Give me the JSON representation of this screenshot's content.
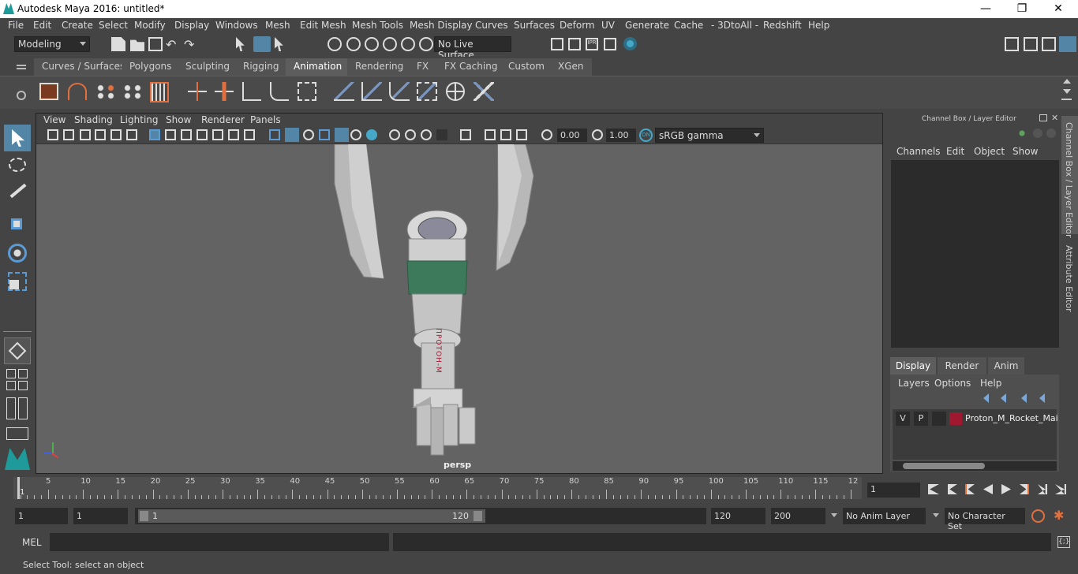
{
  "window": {
    "title": "Autodesk Maya 2016: untitled*"
  },
  "menu": [
    "File",
    "Edit",
    "Create",
    "Select",
    "Modify",
    "Display",
    "Windows",
    "Mesh",
    "Edit Mesh",
    "Mesh Tools",
    "Mesh Display",
    "Curves",
    "Surfaces",
    "Deform",
    "UV",
    "Generate",
    "Cache",
    "- 3DtoAll -",
    "Redshift",
    "Help"
  ],
  "status_line": {
    "mode": "Modeling",
    "live_surface": "No Live Surface"
  },
  "shelf_tabs": [
    "Curves / Surfaces",
    "Polygons",
    "Sculpting",
    "Rigging",
    "Animation",
    "Rendering",
    "FX",
    "FX Caching",
    "Custom",
    "XGen"
  ],
  "active_shelf_tab": "Animation",
  "viewport": {
    "menu": [
      "View",
      "Shading",
      "Lighting",
      "Show",
      "Renderer",
      "Panels"
    ],
    "exposure": "0.00",
    "gamma": "1.00",
    "color_space": "sRGB gamma",
    "camera_label": "persp",
    "scene_object_text": "ПРОТОН-М"
  },
  "channel_box": {
    "title": "Channel Box / Layer Editor",
    "menu": [
      "Channels",
      "Edit",
      "Object",
      "Show"
    ]
  },
  "layer_editor": {
    "tabs": [
      "Display",
      "Render",
      "Anim"
    ],
    "active_tab": "Display",
    "menu": [
      "Layers",
      "Options",
      "Help"
    ],
    "layers": [
      {
        "v": "V",
        "p": "P",
        "name": "Proton_M_Rocket_Mai",
        "color": "#a01830"
      }
    ]
  },
  "side_tabs": [
    "Channel Box / Layer Editor",
    "Attribute Editor"
  ],
  "time_slider": {
    "ticks": [
      "5",
      "10",
      "15",
      "20",
      "25",
      "30",
      "35",
      "40",
      "45",
      "50",
      "55",
      "60",
      "65",
      "70",
      "75",
      "80",
      "85",
      "90",
      "95",
      "100",
      "105",
      "110",
      "115",
      "12"
    ],
    "current_start_label": "1",
    "current_frame": "1"
  },
  "range_slider": {
    "start_frame": "1",
    "playback_start": "1",
    "range_start_label": "1",
    "range_end_label": "120",
    "playback_end": "120",
    "end_frame": "200",
    "anim_layer": "No Anim Layer",
    "character_set": "No Character Set"
  },
  "command_line": {
    "label": "MEL"
  },
  "help_line": {
    "text": "Select Tool: select an object"
  }
}
